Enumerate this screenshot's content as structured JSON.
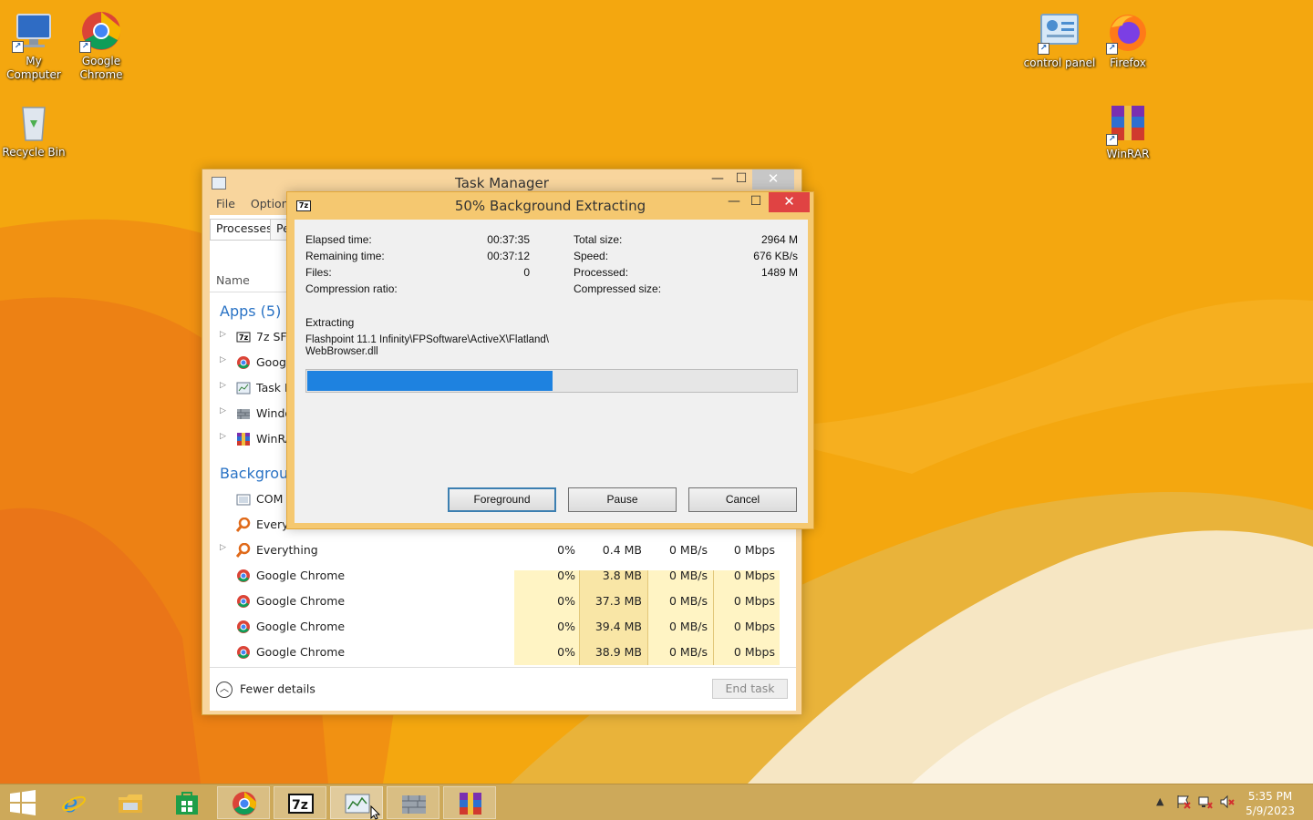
{
  "desktop": {
    "icons": [
      {
        "label": "My\nComputer",
        "icon": "monitor-icon"
      },
      {
        "label": "Google\nChrome",
        "icon": "chrome-icon"
      },
      {
        "label": "Recycle Bin",
        "icon": "recycle-bin-icon"
      },
      {
        "label": "control panel",
        "icon": "control-panel-icon"
      },
      {
        "label": "Firefox",
        "icon": "firefox-icon"
      },
      {
        "label": "WinRAR",
        "icon": "winrar-icon"
      }
    ]
  },
  "task_manager": {
    "title": "Task Manager",
    "menu": [
      "File",
      "Options"
    ],
    "tabs": [
      "Processes",
      "Pe"
    ],
    "column_name": "Name",
    "apps_header": "Apps (5)",
    "background_header": "Backgroun",
    "apps": [
      "7z SFX",
      "Googl",
      "Task M",
      "Windo",
      "WinRA"
    ],
    "background_partial": [
      "COM S",
      "Everyt"
    ],
    "processes": [
      {
        "name": "Everything",
        "cpu": "0%",
        "mem": "0.4 MB",
        "disk": "0 MB/s",
        "net": "0 Mbps",
        "expand": true,
        "icon": "everything-icon"
      },
      {
        "name": "Google Chrome",
        "cpu": "0%",
        "mem": "3.8 MB",
        "disk": "0 MB/s",
        "net": "0 Mbps",
        "expand": false,
        "icon": "chrome-icon"
      },
      {
        "name": "Google Chrome",
        "cpu": "0%",
        "mem": "37.3 MB",
        "disk": "0 MB/s",
        "net": "0 Mbps",
        "expand": false,
        "icon": "chrome-icon"
      },
      {
        "name": "Google Chrome",
        "cpu": "0%",
        "mem": "39.4 MB",
        "disk": "0 MB/s",
        "net": "0 Mbps",
        "expand": false,
        "icon": "chrome-icon"
      },
      {
        "name": "Google Chrome",
        "cpu": "0%",
        "mem": "38.9 MB",
        "disk": "0 MB/s",
        "net": "0 Mbps",
        "expand": false,
        "icon": "chrome-icon"
      }
    ],
    "fewer_details": "Fewer details",
    "end_task": "End task"
  },
  "extract_dialog": {
    "title": "50% Background Extracting",
    "logo": "7z",
    "left": [
      {
        "label": "Elapsed time:",
        "value": "00:37:35"
      },
      {
        "label": "Remaining time:",
        "value": "00:37:12"
      },
      {
        "label": "Files:",
        "value": "0"
      },
      {
        "label": "Compression ratio:",
        "value": ""
      }
    ],
    "right": [
      {
        "label": "Total size:",
        "value": "2964 M"
      },
      {
        "label": "Speed:",
        "value": "676 KB/s"
      },
      {
        "label": "Processed:",
        "value": "1489 M"
      },
      {
        "label": "Compressed size:",
        "value": ""
      }
    ],
    "extracting_label": "Extracting",
    "path_line1": "Flashpoint 11.1 Infinity\\FPSoftware\\ActiveX\\Flatland\\",
    "path_line2": "WebBrowser.dll",
    "progress": 0.5,
    "buttons": {
      "foreground": "Foreground",
      "pause": "Pause",
      "cancel": "Cancel"
    }
  },
  "taskbar": {
    "items": [
      "start-icon",
      "internet-explorer-icon",
      "file-explorer-icon",
      "store-icon",
      "chrome-icon",
      "7zip-icon",
      "task-manager-icon",
      "windows-firewall-icon",
      "winrar-icon"
    ],
    "clock_time": "5:35 PM",
    "clock_date": "5/9/2023"
  },
  "colors": {
    "accent": "#f5c870",
    "progress": "#1e82e0",
    "desktop": "#f2a20e"
  }
}
